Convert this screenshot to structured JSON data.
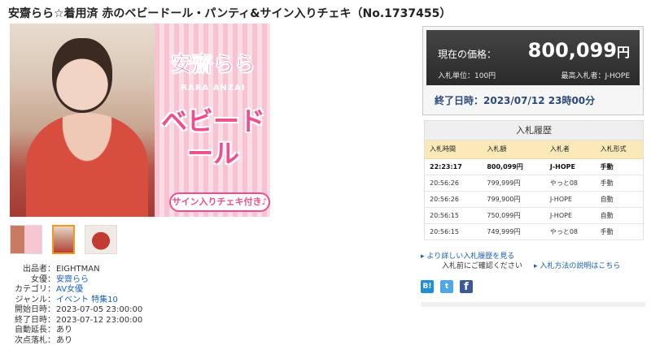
{
  "title": "安齋らら☆着用済 赤のベビードール・パンティ&サイン入りチェキ（No.1737455）",
  "hero": {
    "name": "安齋らら",
    "romaji": "RARA ANZAI",
    "babydoll": "ベビードール",
    "sign": "サイン入りチェキ付き♪"
  },
  "info": [
    {
      "label": "出品者：",
      "value": "EIGHTMAN"
    },
    {
      "label": "女優：",
      "value": "安齋らら"
    },
    {
      "label": "カテゴリ：",
      "value": "AV女優"
    },
    {
      "label": "ジャンル：",
      "value": "イベント 特集10"
    },
    {
      "label": "開始日時：",
      "value": "2023-07-05 23:00:00"
    },
    {
      "label": "終了日時：",
      "value": "2023-07-12 23:00:00"
    },
    {
      "label": "自動延長：",
      "value": "あり"
    },
    {
      "label": "次点落札：",
      "value": "あり"
    }
  ],
  "price": {
    "label": "現在の価格：",
    "value": "800,099",
    "yen": "円",
    "unit": "入札単位：100円",
    "top_bidder": "最高入札者：J-HOPE",
    "end": "終了日時：2023/07/12 23時00分"
  },
  "history": {
    "title": "入札履歴",
    "columns": [
      "入札時間",
      "入札額",
      "入札者",
      "入札形式"
    ],
    "rows": [
      [
        "22:23:17",
        "800,099円",
        "J-HOPE",
        "手動"
      ],
      [
        "20:56:26",
        "799,999円",
        "やっと08",
        "手動"
      ],
      [
        "20:56:26",
        "799,900円",
        "J-HOPE",
        "自動"
      ],
      [
        "20:56:15",
        "750,099円",
        "J-HOPE",
        "自動"
      ],
      [
        "20:56:15",
        "749,999円",
        "やっと08",
        "手動"
      ]
    ]
  },
  "links": {
    "more": "より詳しい入札履歴を見る",
    "confirm": "入札前にご確認ください",
    "howto": "入札方法の説明はこちら"
  },
  "share": {
    "hatena": "B!",
    "twitter": "t",
    "facebook": "f"
  }
}
